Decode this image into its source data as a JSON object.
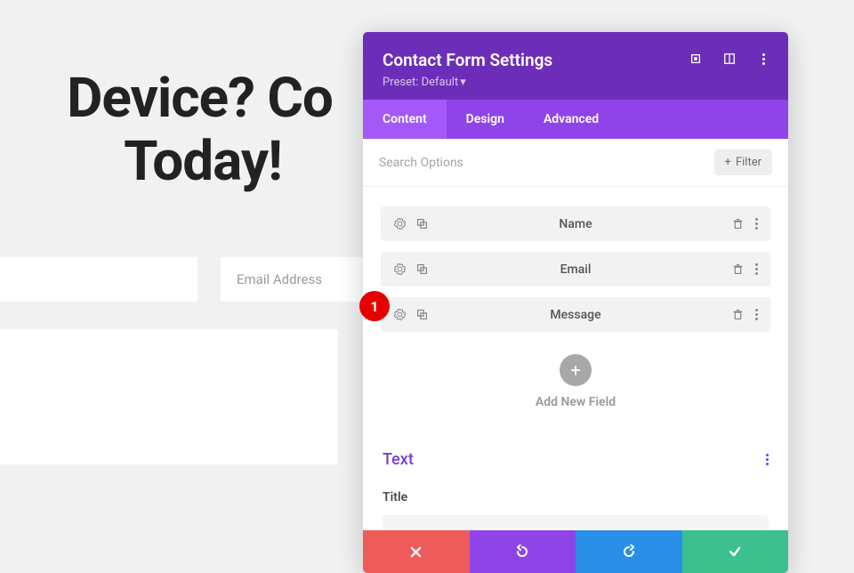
{
  "background": {
    "heading": "Device? Contact Us Today!",
    "inputs": {
      "name_placeholder": "",
      "email_placeholder": "Email Address"
    },
    "annotation_badge": "1"
  },
  "modal": {
    "title": "Contact Form Settings",
    "preset": "Preset: Default",
    "tabs": {
      "content": "Content",
      "design": "Design",
      "advanced": "Advanced"
    },
    "search": {
      "placeholder": "Search Options",
      "filter": "Filter"
    },
    "fields": [
      {
        "label": "Name"
      },
      {
        "label": "Email"
      },
      {
        "label": "Message"
      }
    ],
    "add_field": "Add New Field",
    "section": {
      "title": "Text",
      "field_label": "Title"
    }
  }
}
